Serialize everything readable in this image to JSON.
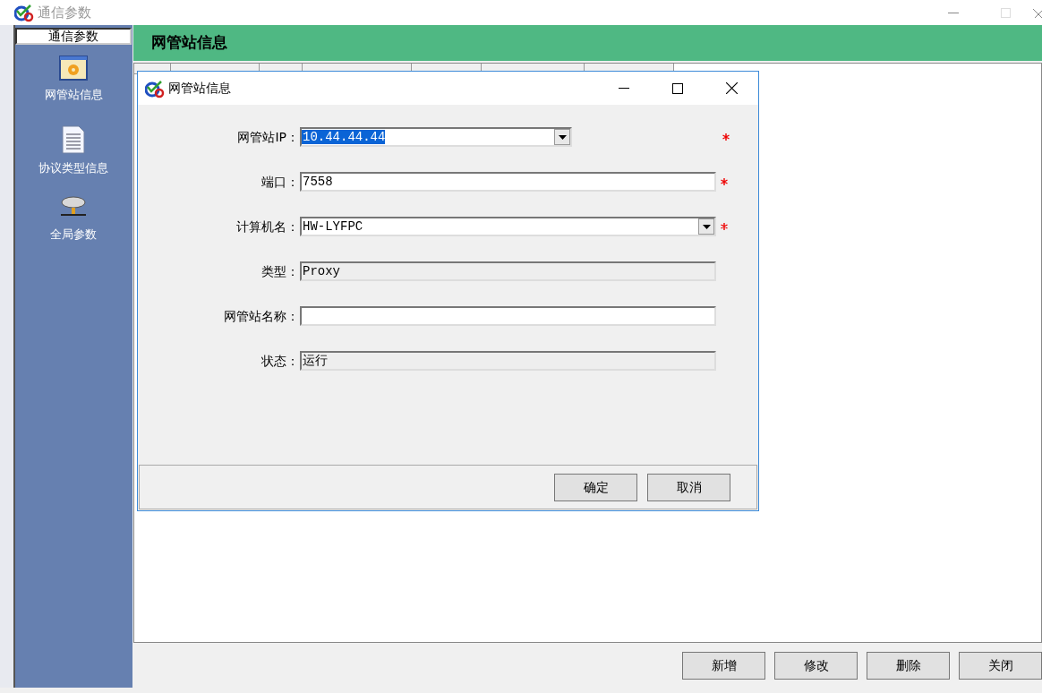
{
  "window": {
    "title": "通信参数"
  },
  "sidebar": {
    "header": "通信参数",
    "items": [
      {
        "label": "网管站信息",
        "kind": "station"
      },
      {
        "label": "协议类型信息",
        "kind": "document"
      },
      {
        "label": "全局参数",
        "kind": "network"
      }
    ]
  },
  "panel": {
    "title": "网管站信息"
  },
  "dialog": {
    "title": "网管站信息",
    "fields": [
      {
        "label": "网管站IP：",
        "kind": "short_combo",
        "value": "10.44.44.44",
        "selected": true,
        "readonly": false,
        "required": true
      },
      {
        "label": "端口：",
        "kind": "text",
        "value": "7558",
        "selected": false,
        "readonly": false,
        "required": true
      },
      {
        "label": "计算机名：",
        "kind": "combo",
        "value": "HW-LYFPC",
        "selected": false,
        "readonly": false,
        "required": true
      },
      {
        "label": "类型：",
        "kind": "text",
        "value": "Proxy",
        "selected": false,
        "readonly": true,
        "required": false
      },
      {
        "label": "网管站名称：",
        "kind": "text",
        "readonly": false,
        "required": false
      },
      {
        "label": "状态：",
        "kind": "text",
        "value": "运行",
        "selected": false,
        "readonly": true,
        "required": false
      }
    ],
    "buttons": [
      "确定",
      "取消"
    ]
  },
  "buttons": [
    "新增",
    "修改",
    "删除",
    "关闭"
  ]
}
